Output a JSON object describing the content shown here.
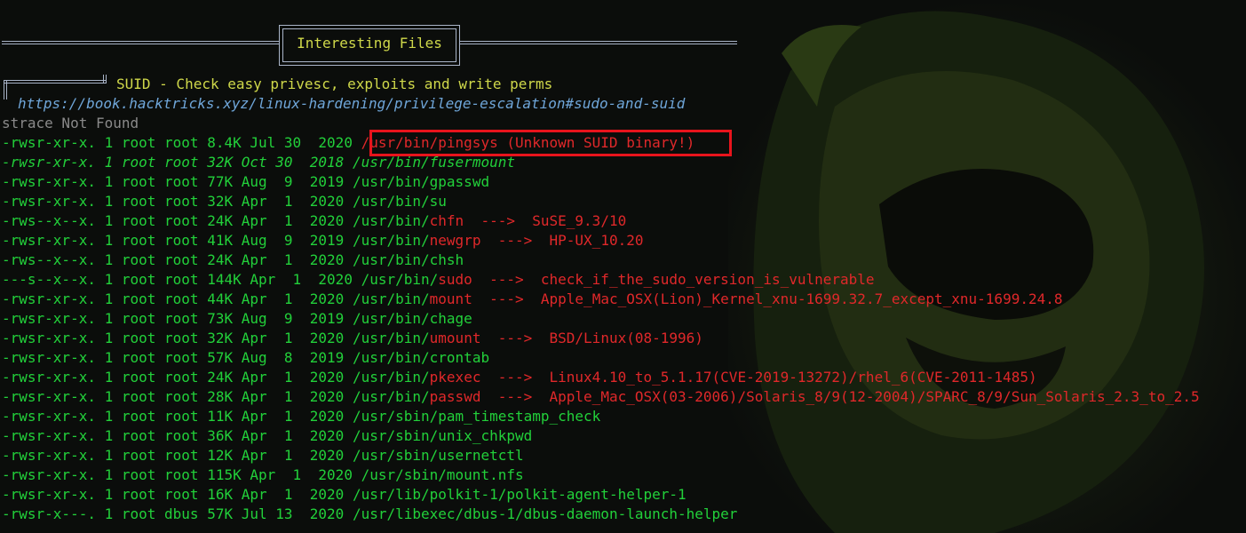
{
  "header": {
    "title": "Interesting Files"
  },
  "section": {
    "title": "SUID - Check easy privesc, exploits and write perms",
    "link": "https://book.hacktricks.xyz/linux-hardening/privilege-escalation#sudo-and-suid",
    "status": "strace Not Found"
  },
  "colors": {
    "background": "#0b0d0b",
    "green": "#22d03a",
    "yellow": "#cfd84a",
    "red": "#e0282a",
    "gray": "#8a8a8a",
    "link_blue": "#6fa6d9",
    "highlight_border": "#e8141c"
  },
  "rows": [
    {
      "meta": "-rwsr-xr-x. 1 root root 8.4K Jul 30  2020 ",
      "dir": "",
      "name": "/usr/bin/pingsys (Unknown SUID binary!)",
      "name_color": "r",
      "note": "",
      "italic": false
    },
    {
      "meta": "-rwsr-xr-x. 1 root root 32K Oct 30  2018 ",
      "dir": "/usr/bin/fusermount",
      "name": "",
      "name_color": "g",
      "note": "",
      "italic": true
    },
    {
      "meta": "-rwsr-xr-x. 1 root root 77K Aug  9  2019 ",
      "dir": "/usr/bin/gpasswd",
      "name": "",
      "name_color": "g",
      "note": "",
      "italic": false
    },
    {
      "meta": "-rwsr-xr-x. 1 root root 32K Apr  1  2020 ",
      "dir": "/usr/bin/su",
      "name": "",
      "name_color": "g",
      "note": "",
      "italic": false
    },
    {
      "meta": "-rws--x--x. 1 root root 24K Apr  1  2020 ",
      "dir": "/usr/bin/",
      "name": "chfn",
      "name_color": "r",
      "note": "  --->  SuSE_9.3/10",
      "italic": false
    },
    {
      "meta": "-rwsr-xr-x. 1 root root 41K Aug  9  2019 ",
      "dir": "/usr/bin/",
      "name": "newgrp",
      "name_color": "r",
      "note": "  --->  HP-UX_10.20",
      "italic": false
    },
    {
      "meta": "-rws--x--x. 1 root root 24K Apr  1  2020 ",
      "dir": "/usr/bin/chsh",
      "name": "",
      "name_color": "g",
      "note": "",
      "italic": false
    },
    {
      "meta": "---s--x--x. 1 root root 144K Apr  1  2020 ",
      "dir": "/usr/bin/",
      "name": "sudo",
      "name_color": "r",
      "note": "  --->  check_if_the_sudo_version_is_vulnerable",
      "italic": false
    },
    {
      "meta": "-rwsr-xr-x. 1 root root 44K Apr  1  2020 ",
      "dir": "/usr/bin/",
      "name": "mount",
      "name_color": "r",
      "note": "  --->  Apple_Mac_OSX(Lion)_Kernel_xnu-1699.32.7_except_xnu-1699.24.8",
      "italic": false
    },
    {
      "meta": "-rwsr-xr-x. 1 root root 73K Aug  9  2019 ",
      "dir": "/usr/bin/chage",
      "name": "",
      "name_color": "g",
      "note": "",
      "italic": false
    },
    {
      "meta": "-rwsr-xr-x. 1 root root 32K Apr  1  2020 ",
      "dir": "/usr/bin/",
      "name": "umount",
      "name_color": "r",
      "note": "  --->  BSD/Linux(08-1996)",
      "italic": false
    },
    {
      "meta": "-rwsr-xr-x. 1 root root 57K Aug  8  2019 ",
      "dir": "/usr/bin/crontab",
      "name": "",
      "name_color": "g",
      "note": "",
      "italic": false
    },
    {
      "meta": "-rwsr-xr-x. 1 root root 24K Apr  1  2020 ",
      "dir": "/usr/bin/",
      "name": "pkexec",
      "name_color": "r",
      "note": "  --->  Linux4.10_to_5.1.17(CVE-2019-13272)/rhel_6(CVE-2011-1485)",
      "italic": false
    },
    {
      "meta": "-rwsr-xr-x. 1 root root 28K Apr  1  2020 ",
      "dir": "/usr/bin/",
      "name": "passwd",
      "name_color": "r",
      "note": "  --->  Apple_Mac_OSX(03-2006)/Solaris_8/9(12-2004)/SPARC_8/9/Sun_Solaris_2.3_to_2.5",
      "italic": false
    },
    {
      "meta": "-rwsr-xr-x. 1 root root 11K Apr  1  2020 ",
      "dir": "/usr/sbin/pam_timestamp_check",
      "name": "",
      "name_color": "g",
      "note": "",
      "italic": false
    },
    {
      "meta": "-rwsr-xr-x. 1 root root 36K Apr  1  2020 ",
      "dir": "/usr/sbin/unix_chkpwd",
      "name": "",
      "name_color": "g",
      "note": "",
      "italic": false
    },
    {
      "meta": "-rwsr-xr-x. 1 root root 12K Apr  1  2020 ",
      "dir": "/usr/sbin/usernetctl",
      "name": "",
      "name_color": "g",
      "note": "",
      "italic": false
    },
    {
      "meta": "-rwsr-xr-x. 1 root root 115K Apr  1  2020 ",
      "dir": "/usr/sbin/mount.nfs",
      "name": "",
      "name_color": "g",
      "note": "",
      "italic": false
    },
    {
      "meta": "-rwsr-xr-x. 1 root root 16K Apr  1  2020 ",
      "dir": "/usr/lib/polkit-1/polkit-agent-helper-1",
      "name": "",
      "name_color": "g",
      "note": "",
      "italic": false
    },
    {
      "meta": "-rwsr-x---. 1 root dbus 57K Jul 13  2020 ",
      "dir": "/usr/libexec/dbus-1/dbus-daemon-launch-helper",
      "name": "",
      "name_color": "g",
      "note": "",
      "italic": false
    }
  ]
}
